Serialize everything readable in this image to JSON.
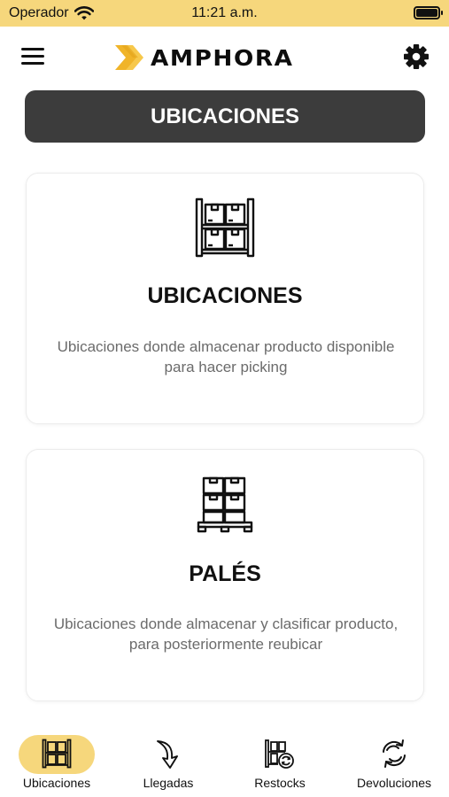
{
  "status_bar": {
    "carrier": "Operador",
    "time": "11:21 a.m."
  },
  "header": {
    "logo_text": "AMPHORA",
    "menu_icon": "hamburger-menu-icon",
    "settings_icon": "gear-icon"
  },
  "section": {
    "title": "UBICACIONES"
  },
  "cards": [
    {
      "icon": "shelving-boxes-icon",
      "title": "UBICACIONES",
      "description": "Ubicaciones donde almacenar producto disponible para hacer picking"
    },
    {
      "icon": "pallet-boxes-icon",
      "title": "PALÉS",
      "description": "Ubicaciones donde almacenar y clasificar producto, para posteriormente reubicar"
    }
  ],
  "tabbar": {
    "items": [
      {
        "label": "Ubicaciones",
        "icon": "shelving-icon",
        "active": true
      },
      {
        "label": "Llegadas",
        "icon": "arrow-down-icon",
        "active": false
      },
      {
        "label": "Restocks",
        "icon": "restock-icon",
        "active": false
      },
      {
        "label": "Devoluciones",
        "icon": "return-arrows-icon",
        "active": false
      }
    ]
  },
  "colors": {
    "accent": "#f6d77c",
    "title_bar": "#3c3c3c",
    "logo_yellow": "#f0b429"
  }
}
